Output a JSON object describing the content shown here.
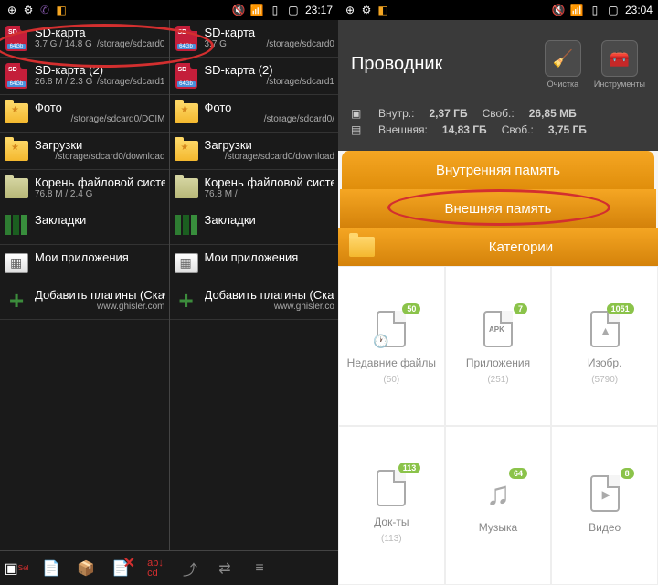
{
  "left": {
    "status": {
      "time": "23:17"
    },
    "paneA": [
      {
        "id": "sd0",
        "icon": "sd",
        "name": "SD-карта",
        "size": "3.7 G / 14.8 G",
        "path": "/storage/sdcard0"
      },
      {
        "id": "sd1",
        "icon": "sd",
        "name": "SD-карта (2)",
        "size": "26.8 M / 2.3 G",
        "path": "/storage/sdcard1"
      },
      {
        "id": "photo",
        "icon": "folder-star",
        "name": "Фото",
        "size": "",
        "path": "/storage/sdcard0/DCIM"
      },
      {
        "id": "downloads",
        "icon": "folder-star",
        "name": "Загрузки",
        "size": "",
        "path": "/storage/sdcard0/download"
      },
      {
        "id": "root",
        "icon": "root",
        "name": "Корень файловой системы",
        "size": "76.8 M / 2.4 G",
        "path": ""
      },
      {
        "id": "bookmarks",
        "icon": "bookmark",
        "name": "Закладки",
        "size": "",
        "path": ""
      },
      {
        "id": "apps",
        "icon": "apps",
        "name": "Мои приложения",
        "size": "",
        "path": ""
      },
      {
        "id": "plugins",
        "icon": "plus",
        "name": "Добавить плагины (Скачать)",
        "size": "",
        "path": "www.ghisler.com"
      }
    ],
    "paneB": [
      {
        "id": "sd0",
        "icon": "sd",
        "name": "SD-карта",
        "size": "3.7 G",
        "path": "/storage/sdcard0"
      },
      {
        "id": "sd1",
        "icon": "sd",
        "name": "SD-карта (2)",
        "size": "",
        "path": "/storage/sdcard1"
      },
      {
        "id": "photo",
        "icon": "folder-star",
        "name": "Фото",
        "size": "",
        "path": "/storage/sdcard0/"
      },
      {
        "id": "downloads",
        "icon": "folder-star",
        "name": "Загрузки",
        "size": "",
        "path": "/storage/sdcard0/download"
      },
      {
        "id": "root",
        "icon": "root",
        "name": "Корень файловой системы",
        "size": "76.8 M /",
        "path": ""
      },
      {
        "id": "bookmarks",
        "icon": "bookmark",
        "name": "Закладки",
        "size": "",
        "path": ""
      },
      {
        "id": "apps",
        "icon": "apps",
        "name": "Мои приложения",
        "size": "",
        "path": ""
      },
      {
        "id": "plugins",
        "icon": "plus",
        "name": "Добавить плагины (Скачать)",
        "size": "",
        "path": "www.ghisler.co"
      }
    ]
  },
  "right": {
    "status": {
      "time": "23:04"
    },
    "title": "Проводник",
    "actions": {
      "clean": "Очистка",
      "tools": "Инструменты"
    },
    "storage": {
      "internal": {
        "label": "Внутр.:",
        "total": "2,37 ГБ",
        "free_label": "Своб.:",
        "free": "26,85 МБ"
      },
      "external": {
        "label": "Внешняя:",
        "total": "14,83 ГБ",
        "free_label": "Своб.:",
        "free": "3,75 ГБ"
      }
    },
    "tabs": {
      "internal": "Внутренняя память",
      "external": "Внешняя память",
      "categories": "Категории"
    },
    "cats": [
      {
        "label": "Недавние файлы",
        "badge": "50",
        "count": "(50)"
      },
      {
        "label": "Приложения",
        "badge": "7",
        "count": "(251)"
      },
      {
        "label": "Изобр.",
        "badge": "1051",
        "count": "(5790)"
      },
      {
        "label": "Док-ты",
        "badge": "113",
        "count": "(113)"
      },
      {
        "label": "Музыка",
        "badge": "64",
        "count": ""
      },
      {
        "label": "Видео",
        "badge": "8",
        "count": ""
      }
    ]
  }
}
